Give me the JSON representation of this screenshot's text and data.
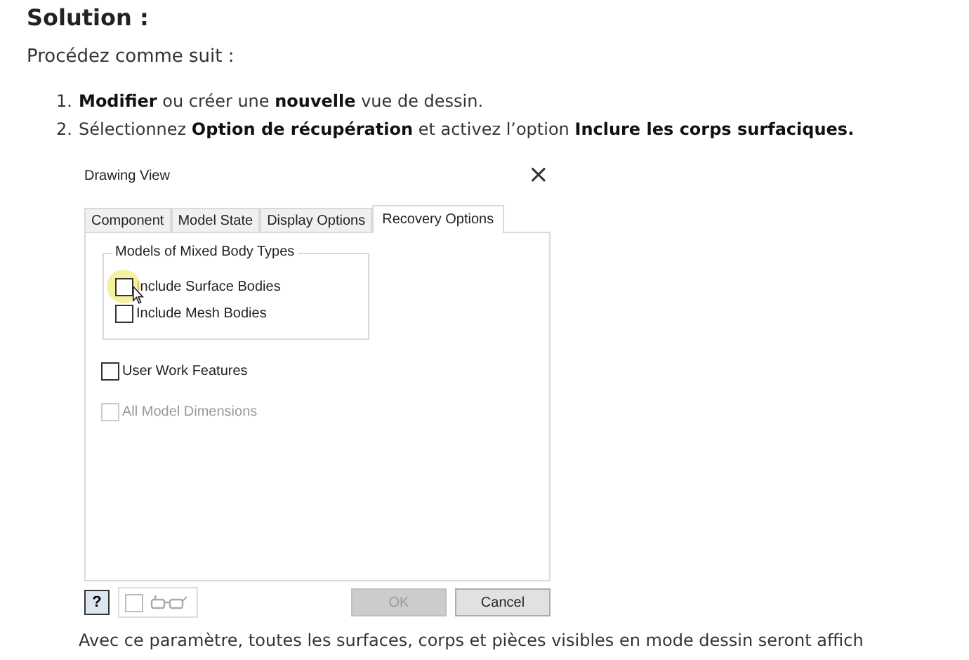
{
  "heading": "Solution :",
  "intro": "Procédez comme suit :",
  "steps": [
    {
      "marker": "1.",
      "text": "**Modifier** ou créer une **nouvelle** vue de dessin."
    },
    {
      "marker": "2.",
      "text": "Sélectionnez **Option de récupération** et activez l’option **Inclure les corps surfaciques.**"
    }
  ],
  "dialog": {
    "title": "Drawing View",
    "close": "×",
    "tabs": [
      {
        "label": "Component",
        "selected": false
      },
      {
        "label": "Model State",
        "selected": false
      },
      {
        "label": "Display Options",
        "selected": false
      },
      {
        "label": "Recovery Options",
        "selected": true
      }
    ],
    "group": {
      "title": "Models of Mixed Body Types",
      "options": [
        {
          "label": "Include Surface Bodies",
          "checked": false,
          "highlighted": true
        },
        {
          "label": "Include Mesh Bodies",
          "checked": false,
          "highlighted": false
        }
      ]
    },
    "options": [
      {
        "label": "User Work Features",
        "checked": false,
        "disabled": false
      },
      {
        "label": "All Model Dimensions",
        "checked": false,
        "disabled": true
      }
    ],
    "footer": {
      "help": "?",
      "preview_checked": false,
      "buttons": [
        {
          "label": "OK",
          "disabled": true
        },
        {
          "label": "Cancel",
          "disabled": false
        }
      ]
    }
  },
  "note": "Avec ce paramètre, toutes les surfaces, corps et pièces visibles en mode dessin seront affich"
}
